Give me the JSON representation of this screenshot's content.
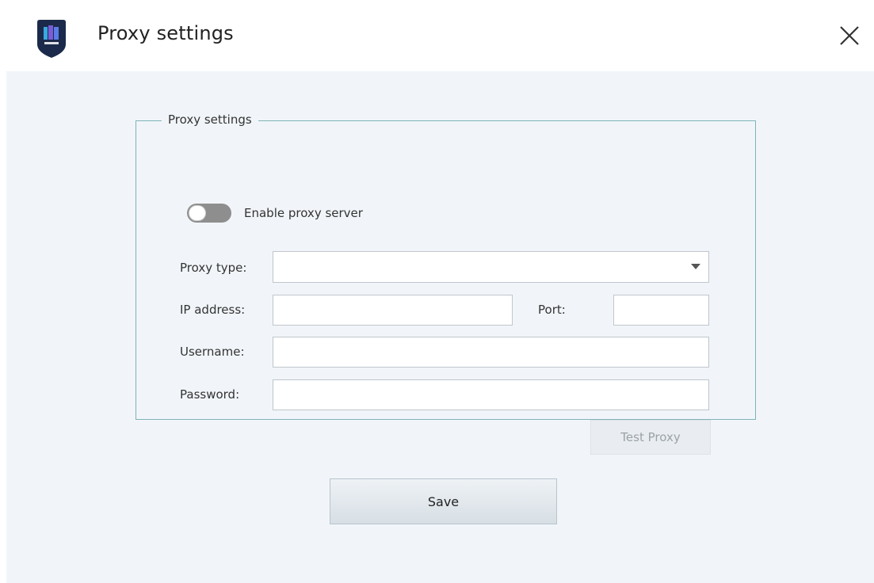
{
  "window": {
    "title": "Proxy settings"
  },
  "icons": {
    "app_logo": "app-logo-icon",
    "close": "close-icon",
    "dropdown": "chevron-down-icon"
  },
  "group": {
    "legend": "Proxy settings",
    "enable_toggle": {
      "label": "Enable proxy server",
      "checked": false
    },
    "fields": {
      "proxy_type": {
        "label": "Proxy type:",
        "value": ""
      },
      "ip_address": {
        "label": "IP address:",
        "value": ""
      },
      "port": {
        "label": "Port:",
        "value": ""
      },
      "username": {
        "label": "Username:",
        "value": ""
      },
      "password": {
        "label": "Password:",
        "value": ""
      }
    },
    "test_button": {
      "label": "Test Proxy",
      "enabled": false
    }
  },
  "footer": {
    "save_label": "Save"
  },
  "colors": {
    "content_bg": "#f1f5f9",
    "group_border": "#7fb3b6",
    "toggle_off": "#8e8e8e",
    "logo_shield": "#1b2a4a"
  }
}
